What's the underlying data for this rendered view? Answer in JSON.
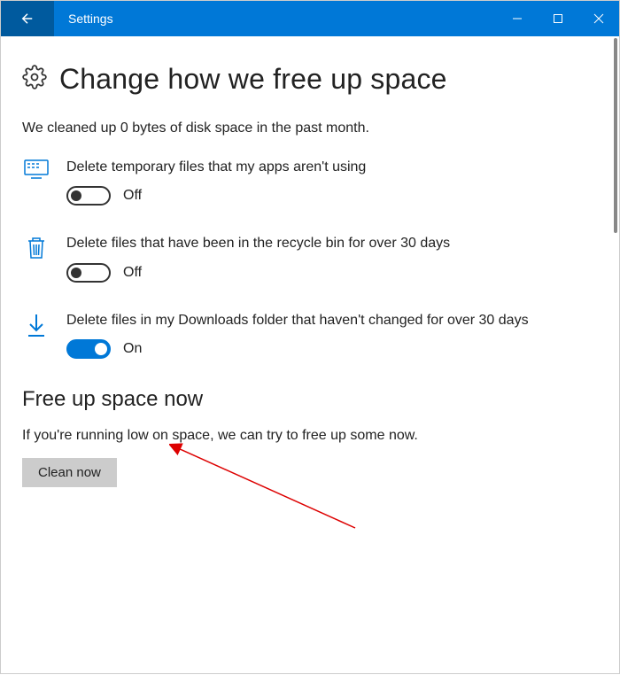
{
  "titlebar": {
    "title": "Settings"
  },
  "page": {
    "heading": "Change how we free up space",
    "status": "We cleaned up 0 bytes of disk space in the past month."
  },
  "options": [
    {
      "label": "Delete temporary files that my apps aren't using",
      "toggle_state": "off",
      "toggle_text": "Off"
    },
    {
      "label": "Delete files that have been in the recycle bin for over 30 days",
      "toggle_state": "off",
      "toggle_text": "Off"
    },
    {
      "label": "Delete files in my Downloads folder that haven't changed for over 30 days",
      "toggle_state": "on",
      "toggle_text": "On"
    }
  ],
  "section2": {
    "heading": "Free up space now",
    "desc": "If you're running low on space, we can try to free up some now.",
    "button": "Clean now"
  }
}
